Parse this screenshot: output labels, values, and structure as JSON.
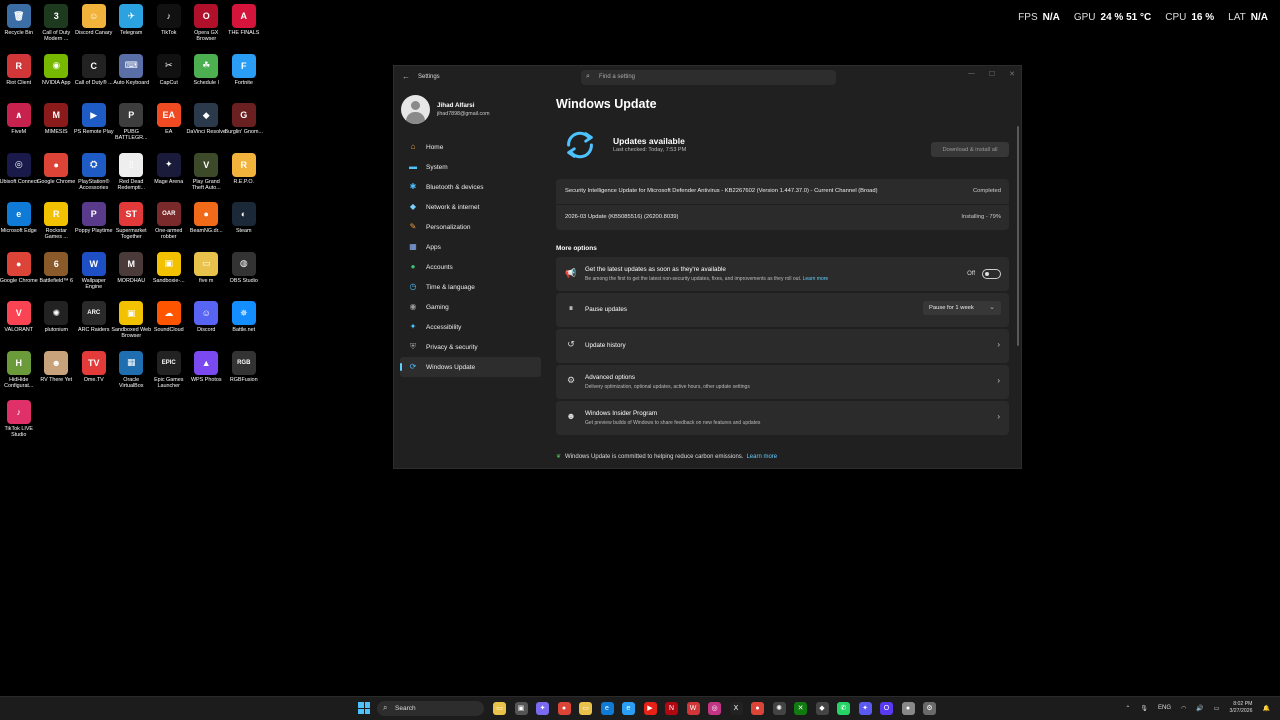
{
  "overlay": [
    {
      "label": "FPS",
      "value": "N/A"
    },
    {
      "label": "GPU",
      "value": "24 % 51 °C"
    },
    {
      "label": "CPU",
      "value": "16 %"
    },
    {
      "label": "LAT",
      "value": "N/A"
    }
  ],
  "desktop_icons": [
    {
      "label": "Recycle Bin",
      "icon": "recycle-bin-icon",
      "color": "#3a6ea5",
      "glyph": "🗑"
    },
    {
      "label": "Call of Duty Modern ...",
      "icon": "call-of-duty-icon",
      "color": "#1e3a1e",
      "glyph": "3"
    },
    {
      "label": "Discord Canary",
      "icon": "discord-canary-icon",
      "color": "#f2b33d",
      "glyph": "☺"
    },
    {
      "label": "Telegram",
      "icon": "telegram-icon",
      "color": "#2aa3e0",
      "glyph": "✈"
    },
    {
      "label": "TikTok",
      "icon": "tiktok-icon",
      "color": "#111111",
      "glyph": "♪"
    },
    {
      "label": "Opera GX Browser",
      "icon": "opera-gx-icon",
      "color": "#b0102a",
      "glyph": "O"
    },
    {
      "label": "THE FINALS",
      "icon": "the-finals-icon",
      "color": "#d4143a",
      "glyph": "A"
    },
    {
      "label": "Riot Client",
      "icon": "riot-client-icon",
      "color": "#d13639",
      "glyph": "R"
    },
    {
      "label": "NVIDIA App",
      "icon": "nvidia-icon",
      "color": "#76b900",
      "glyph": "◉"
    },
    {
      "label": "Call of Duty® ...",
      "icon": "call-of-duty-icon",
      "color": "#222222",
      "glyph": "C"
    },
    {
      "label": "Auto Keyboard",
      "icon": "auto-keyboard-icon",
      "color": "#5a6fa8",
      "glyph": "⌨"
    },
    {
      "label": "CapCut",
      "icon": "capcut-icon",
      "color": "#111111",
      "glyph": "✂"
    },
    {
      "label": "Schedule I",
      "icon": "schedule-i-icon",
      "color": "#4caf50",
      "glyph": "☘"
    },
    {
      "label": "Fortnite",
      "icon": "fortnite-icon",
      "color": "#2a9df4",
      "glyph": "F"
    },
    {
      "label": "FiveM",
      "icon": "fivem-icon",
      "color": "#c6224d",
      "glyph": "∧"
    },
    {
      "label": "MIMESIS",
      "icon": "mimesis-icon",
      "color": "#8b1a1a",
      "glyph": "M"
    },
    {
      "label": "PS Remote Play",
      "icon": "ps-remote-play-icon",
      "color": "#1f5bc4",
      "glyph": "▶"
    },
    {
      "label": "PUBG BATTLEGR...",
      "icon": "pubg-icon",
      "color": "#3d3d3d",
      "glyph": "P"
    },
    {
      "label": "EA",
      "icon": "ea-icon",
      "color": "#f04a23",
      "glyph": "EA"
    },
    {
      "label": "DaVinci Resolve",
      "icon": "davinci-resolve-icon",
      "color": "#2b3a4a",
      "glyph": "◆"
    },
    {
      "label": "Burglin' Gnom...",
      "icon": "burglin-gnomes-icon",
      "color": "#6a2020",
      "glyph": "G"
    },
    {
      "label": "Ubisoft Connect",
      "icon": "ubisoft-connect-icon",
      "color": "#1a1a4a",
      "glyph": "◎"
    },
    {
      "label": "Google Chrome",
      "icon": "chrome-icon",
      "color": "#db4437",
      "glyph": "●"
    },
    {
      "label": "PlayStation® Accessories",
      "icon": "playstation-accessories-icon",
      "color": "#1f5bc4",
      "glyph": "⛭"
    },
    {
      "label": "Red Dead Redempti...",
      "icon": "red-dead-redemption-icon",
      "color": "#eeeeee",
      "glyph": "▯"
    },
    {
      "label": "Mage Arena",
      "icon": "mage-arena-icon",
      "color": "#1a1a3a",
      "glyph": "✦"
    },
    {
      "label": "Play Grand Theft Auto...",
      "icon": "gta-icon",
      "color": "#3d4a2a",
      "glyph": "V"
    },
    {
      "label": "R.E.P.O.",
      "icon": "repo-icon",
      "color": "#f2b33d",
      "glyph": "R"
    },
    {
      "label": "Microsoft Edge",
      "icon": "edge-icon",
      "color": "#0f7bd6",
      "glyph": "e"
    },
    {
      "label": "Rockstar Games ...",
      "icon": "rockstar-icon",
      "color": "#f2c200",
      "glyph": "R"
    },
    {
      "label": "Poppy Playtime",
      "icon": "poppy-playtime-icon",
      "color": "#5a3a8a",
      "glyph": "P"
    },
    {
      "label": "Supermarket Together",
      "icon": "supermarket-together-icon",
      "color": "#e23a3a",
      "glyph": "ST"
    },
    {
      "label": "One-armed robber",
      "icon": "one-armed-robber-icon",
      "color": "#7a2a2a",
      "glyph": "OAR"
    },
    {
      "label": "BeamNG.dr...",
      "icon": "beamng-icon",
      "color": "#f06a1a",
      "glyph": "●"
    },
    {
      "label": "Steam",
      "icon": "steam-icon",
      "color": "#1b2838",
      "glyph": "◐"
    },
    {
      "label": "Google Chrome",
      "icon": "chrome-icon",
      "color": "#db4437",
      "glyph": "●"
    },
    {
      "label": "Battlefield™ 6",
      "icon": "battlefield-6-icon",
      "color": "#8a5a2a",
      "glyph": "6"
    },
    {
      "label": "Wallpaper Engine",
      "icon": "wallpaper-engine-icon",
      "color": "#1f4fc4",
      "glyph": "W"
    },
    {
      "label": "MORDHAU",
      "icon": "mordhau-icon",
      "color": "#4a3a3a",
      "glyph": "M"
    },
    {
      "label": "Sandboxie-...",
      "icon": "sandboxie-icon",
      "color": "#f2c200",
      "glyph": "▣"
    },
    {
      "label": "five m",
      "icon": "folder-icon",
      "color": "#e8c24a",
      "glyph": "▭"
    },
    {
      "label": "OBS Studio",
      "icon": "obs-studio-icon",
      "color": "#333333",
      "glyph": "◍"
    },
    {
      "label": "VALORANT",
      "icon": "valorant-icon",
      "color": "#fa4454",
      "glyph": "V"
    },
    {
      "label": "plutonium",
      "icon": "plutonium-icon",
      "color": "#222222",
      "glyph": "✺"
    },
    {
      "label": "ARC Raiders",
      "icon": "arc-raiders-icon",
      "color": "#2a2a2a",
      "glyph": "ARC"
    },
    {
      "label": "Sandboxed Web Browser",
      "icon": "sandboxed-browser-icon",
      "color": "#f2c200",
      "glyph": "▣"
    },
    {
      "label": "SoundCloud",
      "icon": "soundcloud-icon",
      "color": "#ff5500",
      "glyph": "☁"
    },
    {
      "label": "Discord",
      "icon": "discord-icon",
      "color": "#5865f2",
      "glyph": "☺"
    },
    {
      "label": "Battle.net",
      "icon": "battle-net-icon",
      "color": "#148eff",
      "glyph": "✵"
    },
    {
      "label": "HidHide Configurat...",
      "icon": "hidhide-icon",
      "color": "#6a9a3a",
      "glyph": "H"
    },
    {
      "label": "RV There Yet",
      "icon": "rv-there-yet-icon",
      "color": "#c8a27a",
      "glyph": "☻"
    },
    {
      "label": "Ome.TV",
      "icon": "ome-tv-icon",
      "color": "#e33a3a",
      "glyph": "TV"
    },
    {
      "label": "Oracle VirtualBox",
      "icon": "virtualbox-icon",
      "color": "#1f6fb0",
      "glyph": "▦"
    },
    {
      "label": "Epic Games Launcher",
      "icon": "epic-games-icon",
      "color": "#222222",
      "glyph": "EPIC"
    },
    {
      "label": "WPS Photos",
      "icon": "wps-photos-icon",
      "color": "#7a4af0",
      "glyph": "▲"
    },
    {
      "label": "RGBFusion",
      "icon": "rgbfusion-icon",
      "color": "#333333",
      "glyph": "RGB"
    },
    {
      "label": "TikTok LIVE Studio",
      "icon": "tiktok-live-studio-icon",
      "color": "#e0306a",
      "glyph": "♪"
    }
  ],
  "window": {
    "app_title": "Settings",
    "search_placeholder": "Find a setting",
    "profile": {
      "name": "Jihad Alfarsi",
      "email": "jihad7898@gmail.com"
    },
    "nav": [
      {
        "label": "Home",
        "icon": "home-icon",
        "glyph": "⌂",
        "color": "#e8a44a"
      },
      {
        "label": "System",
        "icon": "system-icon",
        "glyph": "▬",
        "color": "#4cc2ff"
      },
      {
        "label": "Bluetooth & devices",
        "icon": "bluetooth-icon",
        "glyph": "✱",
        "color": "#4cc2ff"
      },
      {
        "label": "Network & internet",
        "icon": "network-icon",
        "glyph": "◆",
        "color": "#7ad0ff"
      },
      {
        "label": "Personalization",
        "icon": "personalization-icon",
        "glyph": "✎",
        "color": "#f0a040"
      },
      {
        "label": "Apps",
        "icon": "apps-icon",
        "glyph": "▦",
        "color": "#8ab4f8"
      },
      {
        "label": "Accounts",
        "icon": "accounts-icon",
        "glyph": "●",
        "color": "#3cc07a"
      },
      {
        "label": "Time & language",
        "icon": "time-language-icon",
        "glyph": "◷",
        "color": "#4cc2ff"
      },
      {
        "label": "Gaming",
        "icon": "gaming-icon",
        "glyph": "◉",
        "color": "#9a9a9a"
      },
      {
        "label": "Accessibility",
        "icon": "accessibility-icon",
        "glyph": "✦",
        "color": "#4cc2ff"
      },
      {
        "label": "Privacy & security",
        "icon": "privacy-security-icon",
        "glyph": "⛨",
        "color": "#9a9a9a"
      },
      {
        "label": "Windows Update",
        "icon": "windows-update-icon",
        "glyph": "⟳",
        "color": "#4cc2ff"
      }
    ],
    "active_nav_index": 11,
    "page_title": "Windows Update",
    "status": {
      "title": "Updates available",
      "subtitle": "Last checked: Today, 7:53 PM",
      "button": "Download & install all"
    },
    "updates": [
      {
        "name": "Security Intelligence Update for Microsoft Defender Antivirus - KB2267602 (Version 1.447.37.0) - Current Channel (Broad)",
        "status": "Completed"
      },
      {
        "name": "2026-03 Update (KB5085516) (26200.8039)",
        "status": "Installing - 79%"
      }
    ],
    "more_options_heading": "More options",
    "options": {
      "latest": {
        "title": "Get the latest updates as soon as they're available",
        "subtitle": "Be among the first to get the latest non-security updates, fixes, and improvements as they roll out.",
        "link": "Learn more",
        "toggle_label": "Off"
      },
      "pause": {
        "title": "Pause updates",
        "select": "Pause for 1 week"
      },
      "history": {
        "title": "Update history"
      },
      "advanced": {
        "title": "Advanced options",
        "subtitle": "Delivery optimization, optional updates, active hours, other update settings"
      },
      "insider": {
        "title": "Windows Insider Program",
        "subtitle": "Get preview builds of Windows to share feedback on new features and updates"
      }
    },
    "carbon": {
      "text": "Windows Update is committed to helping reduce carbon emissions.",
      "link": "Learn more"
    }
  },
  "taskbar": {
    "search_label": "Search",
    "apps": [
      {
        "icon": "file-explorer-icon",
        "color": "#e8c24a"
      },
      {
        "icon": "task-view-icon",
        "color": "#555555"
      },
      {
        "icon": "copilot-icon",
        "color": "#7a6af0"
      },
      {
        "icon": "chrome-icon",
        "color": "#db4437"
      },
      {
        "icon": "folder-icon",
        "color": "#e8c24a"
      },
      {
        "icon": "edge-icon",
        "color": "#0f7bd6"
      },
      {
        "icon": "edge-beta-icon",
        "color": "#2a9df4"
      },
      {
        "icon": "youtube-icon",
        "color": "#e62117"
      },
      {
        "icon": "netflix-icon",
        "color": "#b00710"
      },
      {
        "icon": "wps-office-icon",
        "color": "#d13639"
      },
      {
        "icon": "instagram-icon",
        "color": "#c13584"
      },
      {
        "icon": "x-icon",
        "color": "#222222"
      },
      {
        "icon": "chrome-icon",
        "color": "#db4437"
      },
      {
        "icon": "chatgpt-icon",
        "color": "#444444"
      },
      {
        "icon": "xbox-icon",
        "color": "#107c10"
      },
      {
        "icon": "roblox-icon",
        "color": "#444444"
      },
      {
        "icon": "whatsapp-icon",
        "color": "#25d366"
      },
      {
        "icon": "copilot-app-icon",
        "color": "#5a5af0"
      },
      {
        "icon": "opera-icon",
        "color": "#5a3af0"
      },
      {
        "icon": "chrome-dev-icon",
        "color": "#888888"
      },
      {
        "icon": "settings-icon",
        "color": "#6a6a6a"
      }
    ],
    "tray": {
      "language": "ENG",
      "time": "8:02 PM",
      "date": "3/27/2026"
    }
  }
}
